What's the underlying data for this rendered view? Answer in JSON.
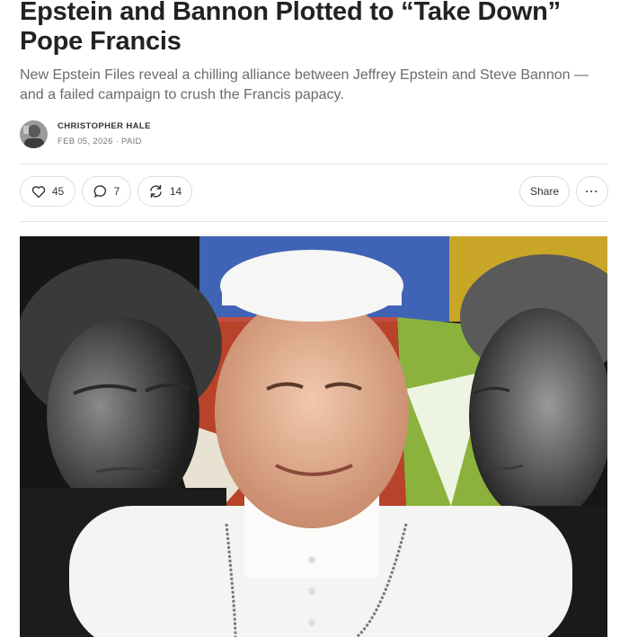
{
  "article": {
    "title": "Epstein and Bannon Plotted to “Take Down” Pope Francis",
    "subtitle": "New Epstein Files reveal a chilling alliance between Jeffrey Epstein and Steve Bannon — and a failed campaign to crush the Francis papacy.",
    "author": "CHRISTOPHER HALE",
    "meta": "FEB 05, 2026 · PAID"
  },
  "actions": {
    "likes": "45",
    "comments": "7",
    "restacks": "14",
    "share_label": "Share",
    "more_label": "···"
  },
  "icons": {
    "like": "heart-icon",
    "comment": "comment-bubble-icon",
    "restack": "restack-arrows-icon",
    "more": "ellipsis-icon"
  },
  "colors": {
    "text": "#222222",
    "muted": "#6b6b6b",
    "border": "#dcdcdc"
  }
}
